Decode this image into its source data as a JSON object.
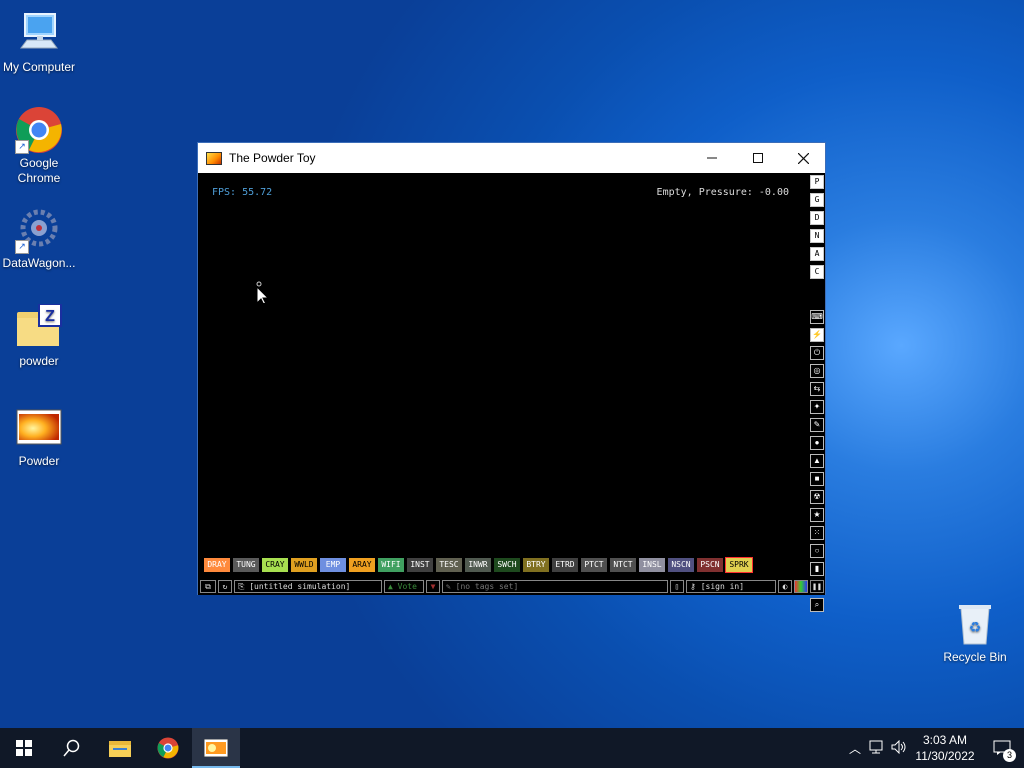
{
  "desktop": {
    "icons": [
      {
        "label": "My Computer"
      },
      {
        "label": "Google Chrome"
      },
      {
        "label": "DataWagon..."
      },
      {
        "label": "powder"
      },
      {
        "label": "Powder"
      },
      {
        "label": "Recycle Bin"
      }
    ]
  },
  "window": {
    "title": "The Powder Toy",
    "fps": "FPS: 55.72",
    "status": "Empty, Pressure: -0.00",
    "side_top": [
      "P",
      "G",
      "D",
      "N",
      "A",
      "C"
    ],
    "elements": [
      {
        "label": "DRAY",
        "color": "#ff8a3c"
      },
      {
        "label": "TUNG",
        "color": "#5a5a5a"
      },
      {
        "label": "CRAY",
        "color": "#a8e050"
      },
      {
        "label": "WWLD",
        "color": "#e0a020"
      },
      {
        "label": "EMP",
        "color": "#6e8fe0"
      },
      {
        "label": "ARAY",
        "color": "#f0a020"
      },
      {
        "label": "WIFI",
        "color": "#40a060"
      },
      {
        "label": "INST",
        "color": "#404040"
      },
      {
        "label": "TESC",
        "color": "#606050"
      },
      {
        "label": "INWR",
        "color": "#505a50"
      },
      {
        "label": "SWCH",
        "color": "#1e4a1e"
      },
      {
        "label": "BTRY",
        "color": "#807020"
      },
      {
        "label": "ETRD",
        "color": "#404040"
      },
      {
        "label": "PTCT",
        "color": "#505050"
      },
      {
        "label": "NTCT",
        "color": "#505050"
      },
      {
        "label": "INSL",
        "color": "#9090a0"
      },
      {
        "label": "NSCN",
        "color": "#505080"
      },
      {
        "label": "PSCN",
        "color": "#803030"
      },
      {
        "label": "SPRK",
        "color": "#e0d050"
      }
    ],
    "bottom": {
      "sim_name": "[untitled simulation]",
      "vote": "Vote",
      "tags": "[no tags set]",
      "sign_in": "[sign in]"
    }
  },
  "taskbar": {
    "time": "3:03 AM",
    "date": "11/30/2022",
    "notifications": "3"
  }
}
